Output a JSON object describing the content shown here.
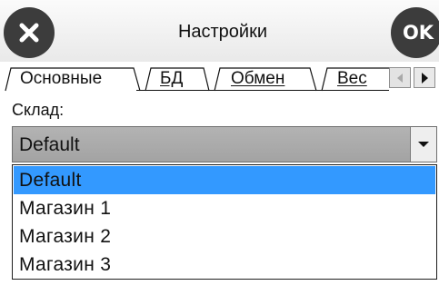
{
  "header": {
    "title": "Настройки",
    "close_icon": "close-x-icon",
    "ok_label": "OK"
  },
  "tabs": [
    {
      "label": "Основные",
      "active": true
    },
    {
      "label": "БД",
      "active": false
    },
    {
      "label": "Обмен",
      "active": false
    },
    {
      "label": "Вес",
      "active": false
    }
  ],
  "tab_scroll": {
    "left_icon": "scroll-left-icon",
    "right_icon": "scroll-right-icon"
  },
  "warehouse": {
    "label": "Склад:",
    "selected": "Default",
    "options": [
      "Default",
      "Магазин 1",
      "Магазин 2",
      "Магазин 3"
    ],
    "highlighted_index": 0
  },
  "colors": {
    "header_buttons": "#3c3c3c",
    "selection": "#3399ff",
    "select_field": "#a8a8a8"
  }
}
